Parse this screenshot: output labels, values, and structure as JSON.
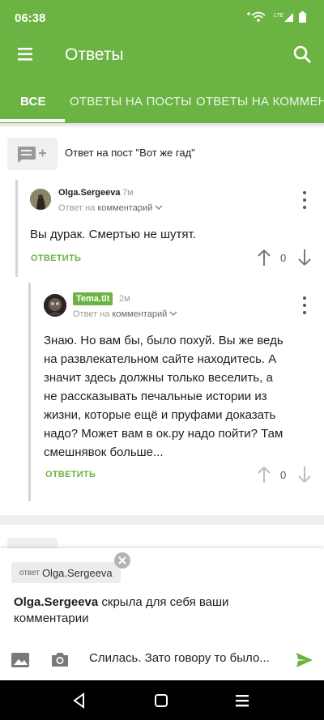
{
  "status": {
    "time": "06:38"
  },
  "toolbar": {
    "title": "Ответы"
  },
  "tabs": [
    {
      "label": "ВСЕ",
      "active": true
    },
    {
      "label": "ОТВЕТЫ НА ПОСТЫ",
      "active": false
    },
    {
      "label": "ОТВЕТЫ НА КОММЕНТАРИИ",
      "active": false
    }
  ],
  "post": {
    "title": "Ответ на пост \"Вот же гад\""
  },
  "comments": [
    {
      "author": "Olga.Sergeeva",
      "time": "7м",
      "reply_prefix": "Ответ на",
      "reply_target": "комментарий",
      "text": "Вы дурак. Смертью не шутят.",
      "reply_label": "ОТВЕТИТЬ",
      "score": "0"
    },
    {
      "author": "Tema.tlt",
      "time": "2м",
      "reply_prefix": "Ответ на",
      "reply_target": "комментарий",
      "text_lines": [
        "Знаю. Но вам бы, было похуй. Вы же ведь",
        "на развлекательном сайте находитесь. А",
        "значит здесь должны только веселить, а",
        "не рассказывать печальные истории из",
        "жизни, которые ещё и пруфами доказать",
        "надо? Может вам в ок.ру надо пойти? Там",
        "смешнявок больше..."
      ],
      "reply_label": "ОТВЕТИТЬ",
      "score": "0"
    }
  ],
  "reply_chip": {
    "prefix": "ответ",
    "name": "Olga.Sergeeva"
  },
  "notice": {
    "name": "Olga.Sergeeva",
    "text": "скрыла для себя ваши комментарии"
  },
  "composer": {
    "value": "Слилась. Зато говору то было..."
  },
  "colors": {
    "accent": "#6bb342"
  }
}
